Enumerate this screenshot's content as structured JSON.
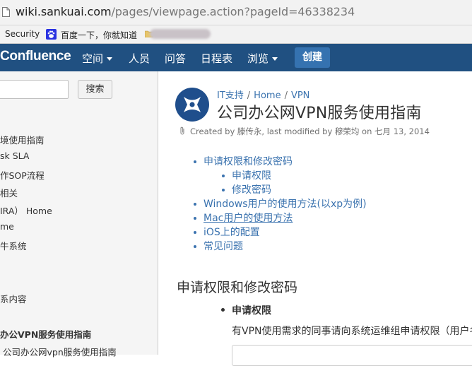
{
  "browser": {
    "url_host": "wiki.sankuai.com",
    "url_path": "/pages/viewpage.action?pageId=46338234",
    "bookmarks": [
      "Security",
      "百度一下，你就知道"
    ]
  },
  "header": {
    "logo": "Confluence",
    "nav": [
      {
        "label": "空间",
        "has_caret": true
      },
      {
        "label": "人员",
        "has_caret": false
      },
      {
        "label": "问答",
        "has_caret": false
      },
      {
        "label": "日程表",
        "has_caret": false
      },
      {
        "label": "浏览",
        "has_caret": true
      }
    ],
    "create_label": "创建",
    "bar_color": "#205081",
    "create_color": "#3572b0"
  },
  "sidebar": {
    "search_button": "搜索",
    "links": [
      "境使用指南",
      "sk SLA",
      "作SOP流程",
      "相关",
      "IRA） Home",
      "me",
      "牛系统",
      "系内容"
    ],
    "current_page": "办公VPN服务使用指南",
    "child_page": "公司办公网vpn服务使用指南"
  },
  "page": {
    "breadcrumbs": [
      "IT支持",
      "Home",
      "VPN"
    ],
    "title": "公司办公网VPN服务使用指南",
    "meta": "Created by 滕传永, last modified by 穆荣均 on 七月 13, 2014",
    "toc": [
      {
        "label": "申请权限和修改密码",
        "level": 1,
        "underline": false
      },
      {
        "label": "申请权限",
        "level": 2,
        "underline": false
      },
      {
        "label": "修改密码",
        "level": 2,
        "underline": false
      },
      {
        "label": "Windows用户的使用方法(以xp为例)",
        "level": 1,
        "underline": false
      },
      {
        "label": "Mac用户的使用方法",
        "level": 1,
        "underline": true
      },
      {
        "label": "iOS上的配置",
        "level": 1,
        "underline": false
      },
      {
        "label": "常见问题",
        "level": 1,
        "underline": false
      }
    ],
    "section_heading": "申请权限和修改密码",
    "sub_heading": "申请权限",
    "paragraph": "有VPN使用需求的同事请向系统运维组申请权限（用户名",
    "link_color": "#3b73af"
  }
}
